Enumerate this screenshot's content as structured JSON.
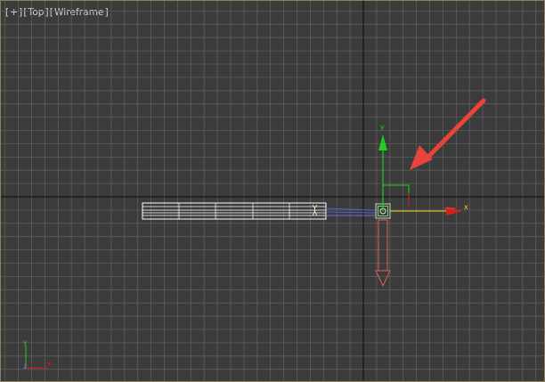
{
  "viewport": {
    "label_parts": [
      "+",
      "Top",
      "Wireframe"
    ],
    "gizmo_x_label": "x",
    "gizmo_y_label": "y",
    "mini_axis_x": "x",
    "mini_axis_y": "y",
    "mini_axis_z": "z"
  },
  "colors": {
    "background": "#3b3b3b",
    "grid_line": "#5e5e5e",
    "world_axis": "#151515",
    "object_wire": "#ffffff",
    "x_axis": "#e02020",
    "y_axis": "#22cc22",
    "gizmo_x_label": "#ffd700",
    "annotation_arrow": "#e8443a"
  },
  "icons": [
    "move-gizmo-icon",
    "pivot-point-icon",
    "annotation-arrow-icon",
    "view-axis-tripod-icon"
  ]
}
